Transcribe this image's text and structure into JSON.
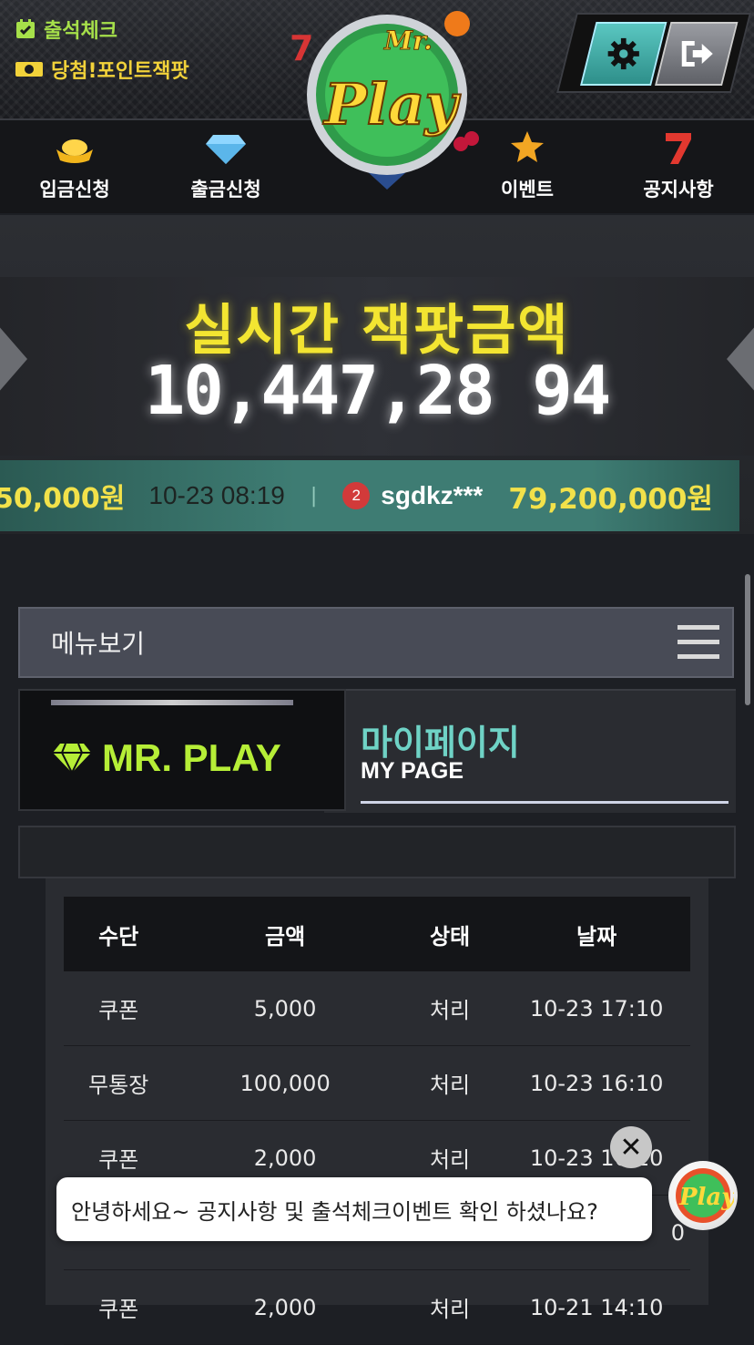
{
  "header": {
    "attendance_label": "출석체크",
    "jackpot_point_label": "당첨!포인트잭팟",
    "logo_top": "Mr.",
    "logo_main": "Play"
  },
  "nav": {
    "items": [
      {
        "label": "입금신청",
        "icon": "gold-ingot-icon"
      },
      {
        "label": "출금신청",
        "icon": "diamond-icon"
      },
      {
        "label": "이벤트",
        "icon": "star-icon"
      },
      {
        "label": "공지사항",
        "icon": "seven-icon"
      }
    ]
  },
  "jackpot": {
    "title": "실시간 잭팟금액",
    "amount": "10,447,28 94"
  },
  "ticker": {
    "prev_amount": "50,000원",
    "date": "10-23 08:19",
    "separator": "|",
    "rank": "2",
    "user": "sgdkz***",
    "amount": "79,200,000원"
  },
  "menu": {
    "label": "메뉴보기"
  },
  "mypage": {
    "brand": "MR. PLAY",
    "title_ko": "마이페이지",
    "title_en": "MY PAGE"
  },
  "history": {
    "headers": [
      "수단",
      "금액",
      "상태",
      "날짜"
    ],
    "rows": [
      [
        "쿠폰",
        "5,000",
        "처리",
        "10-23 17:10"
      ],
      [
        "무통장",
        "100,000",
        "처리",
        "10-23 16:10"
      ],
      [
        "쿠폰",
        "2,000",
        "처리",
        "10-23 16:10"
      ],
      [
        "",
        "",
        "",
        "0"
      ],
      [
        "쿠폰",
        "2,000",
        "처리",
        "10-21 14:10"
      ]
    ]
  },
  "chat": {
    "message": "안녕하세요~ 공지사항 및 출석체크이벤트 확인 하셨나요?",
    "close_glyph": "✕"
  },
  "colors": {
    "accent_green": "#b6ee37",
    "accent_teal": "#6fd3c6",
    "jackpot_yellow": "#f3e531",
    "ticker_bg": "#3e7c73"
  }
}
